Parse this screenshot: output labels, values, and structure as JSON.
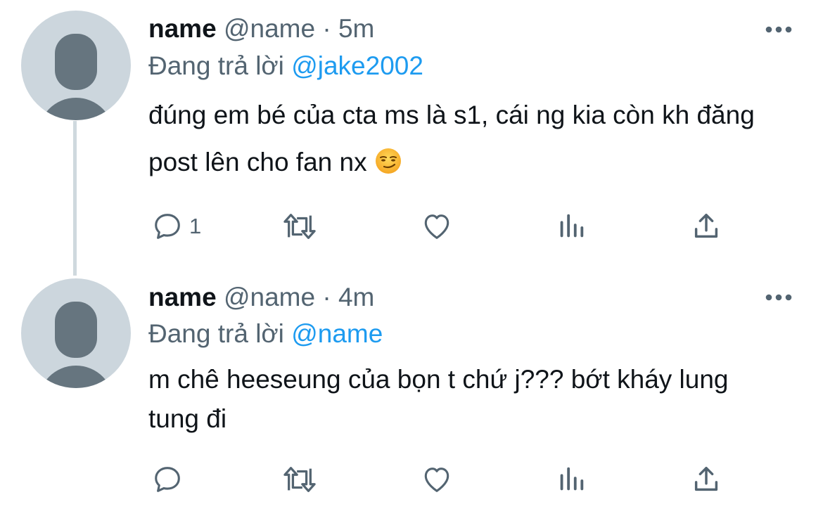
{
  "tweets": [
    {
      "name": "name",
      "handle": "@name",
      "separator": "·",
      "time": "5m",
      "reply_prefix": "Đang trả lời",
      "reply_to": "@jake2002",
      "text": "đúng em bé của cta ms là s1, cái ng kia còn kh đăng post lên cho fan nx",
      "emoji": "smirking-face",
      "reply_count": "1"
    },
    {
      "name": "name",
      "handle": "@name",
      "separator": "·",
      "time": "4m",
      "reply_prefix": "Đang trả lời",
      "reply_to": "@name",
      "text": "m chê heeseung của bọn t chứ j??? bớt kháy lung tung đi",
      "reply_count": ""
    }
  ],
  "colors": {
    "text": "#0f1419",
    "muted": "#536471",
    "link": "#1d9bf0",
    "avatar_bg": "#ccd6dd",
    "avatar_fg": "#66757f",
    "thread_line": "#cfd9de"
  },
  "icons": [
    "reply-icon",
    "retweet-icon",
    "like-icon",
    "views-icon",
    "share-icon",
    "more-icon"
  ]
}
